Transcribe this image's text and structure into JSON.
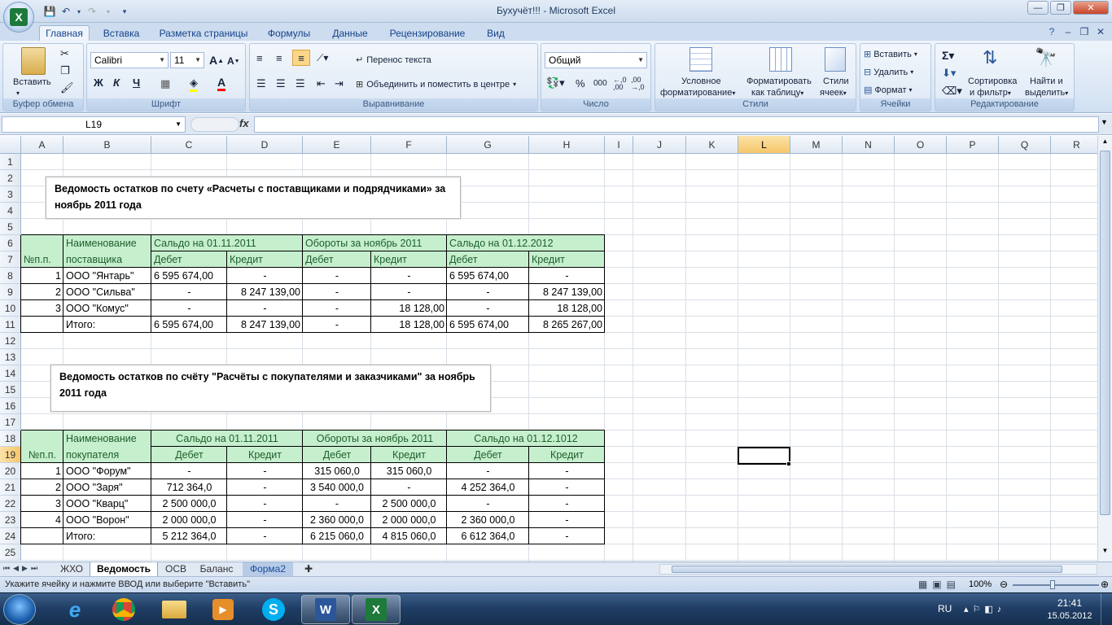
{
  "window": {
    "title": "Бухучёт!!! - Microsoft Excel"
  },
  "ribbon": {
    "tabs": [
      "Главная",
      "Вставка",
      "Разметка страницы",
      "Формулы",
      "Данные",
      "Рецензирование",
      "Вид"
    ],
    "clipboard": {
      "label": "Буфер обмена",
      "paste": "Вставить"
    },
    "font": {
      "label": "Шрифт",
      "name": "Calibri",
      "size": "11",
      "bold": "Ж",
      "italic": "К",
      "underline": "Ч"
    },
    "alignment": {
      "label": "Выравнивание",
      "wrap": "Перенос текста",
      "merge": "Объединить и поместить в центре"
    },
    "number": {
      "label": "Число",
      "format": "Общий"
    },
    "styles": {
      "label": "Стили",
      "conditional": "Условное",
      "conditional2": "форматирование",
      "format_table": "Форматировать",
      "format_table2": "как таблицу",
      "cell_styles": "Стили",
      "cell_styles2": "ячеек"
    },
    "cells": {
      "label": "Ячейки",
      "insert": "Вставить",
      "delete": "Удалить",
      "format": "Формат"
    },
    "editing": {
      "label": "Редактирование",
      "sort": "Сортировка",
      "sort2": "и фильтр",
      "find": "Найти и",
      "find2": "выделить"
    }
  },
  "formula_bar": {
    "name_box": "L19",
    "fx": "fx",
    "value": ""
  },
  "columns": [
    "A",
    "B",
    "C",
    "D",
    "E",
    "F",
    "G",
    "H",
    "I",
    "J",
    "K",
    "L",
    "M",
    "N",
    "O",
    "P",
    "Q",
    "R"
  ],
  "rows": [
    "1",
    "2",
    "3",
    "4",
    "5",
    "6",
    "7",
    "8",
    "9",
    "10",
    "11",
    "12",
    "13",
    "14",
    "15",
    "16",
    "17",
    "18",
    "19",
    "20",
    "21",
    "22",
    "23",
    "24",
    "25"
  ],
  "textbox1": "Ведомость остатков по счету «Расчеты с поставщиками и подрядчиками» за ноябрь 2011 года",
  "textbox2": "Ведомость остатков по счёту \"Расчёты с покупателями и заказчиками\" за ноябрь 2011 года",
  "table1": {
    "h_num": "№п.п.",
    "h_name1": "Наименование",
    "h_name2": "поставщика",
    "h_g1": "Сальдо на 01.11.2011",
    "h_g2": "Обороты за ноябрь 2011",
    "h_g3": "Сальдо на 01.12.2012",
    "debit": "Дебет",
    "credit": "Кредит",
    "rows": [
      [
        "1",
        "ООО \"Янтарь\"",
        "6 595 674,00",
        "-",
        "-",
        "-",
        "6 595 674,00",
        "-"
      ],
      [
        "2",
        "ООО \"Сильва\"",
        "-",
        "8 247 139,00",
        "-",
        "-",
        "-",
        "8 247 139,00"
      ],
      [
        "3",
        "ООО \"Комус\"",
        "-",
        "-",
        "-",
        "18 128,00",
        "-",
        "18 128,00"
      ],
      [
        "",
        "Итого:",
        "6 595 674,00",
        "8 247 139,00",
        "-",
        "18 128,00",
        "6 595 674,00",
        "8 265 267,00"
      ]
    ]
  },
  "table2": {
    "h_num": "№п.п.",
    "h_name1": "Наименование",
    "h_name2": "покупателя",
    "h_g1": "Сальдо на 01.11.2011",
    "h_g2": "Обороты за ноябрь 2011",
    "h_g3": "Сальдо на 01.12.1012",
    "debit": "Дебет",
    "credit": "Кредит",
    "rows": [
      [
        "1",
        "ООО \"Форум\"",
        "-",
        "-",
        "315 060,0",
        "315 060,0",
        "-",
        "-"
      ],
      [
        "2",
        "ООО \"Заря\"",
        "712 364,0",
        "-",
        "3 540 000,0",
        "-",
        "4 252 364,0",
        "-"
      ],
      [
        "3",
        "ООО \"Кварц\"",
        "2 500 000,0",
        "-",
        "-",
        "2 500 000,0",
        "-",
        "-"
      ],
      [
        "4",
        "ООО \"Ворон\"",
        "2 000 000,0",
        "-",
        "2 360 000,0",
        "2 000 000,0",
        "2 360 000,0",
        "-"
      ],
      [
        "",
        "Итого:",
        "5 212 364,0",
        "-",
        "6 215 060,0",
        "4 815 060,0",
        "6 612 364,0",
        "-"
      ]
    ]
  },
  "sheets": [
    "ЖХО",
    "Ведомость",
    "ОСВ",
    "Баланс",
    "Форма2"
  ],
  "status": {
    "message": "Укажите ячейку и нажмите ВВОД или выберите \"Вставить\"",
    "zoom": "100%"
  },
  "taskbar": {
    "lang": "RU",
    "time": "21:41",
    "date": "15.05.2012"
  },
  "colors": {
    "header_green": "#c6efce",
    "accent": "#15428b"
  }
}
